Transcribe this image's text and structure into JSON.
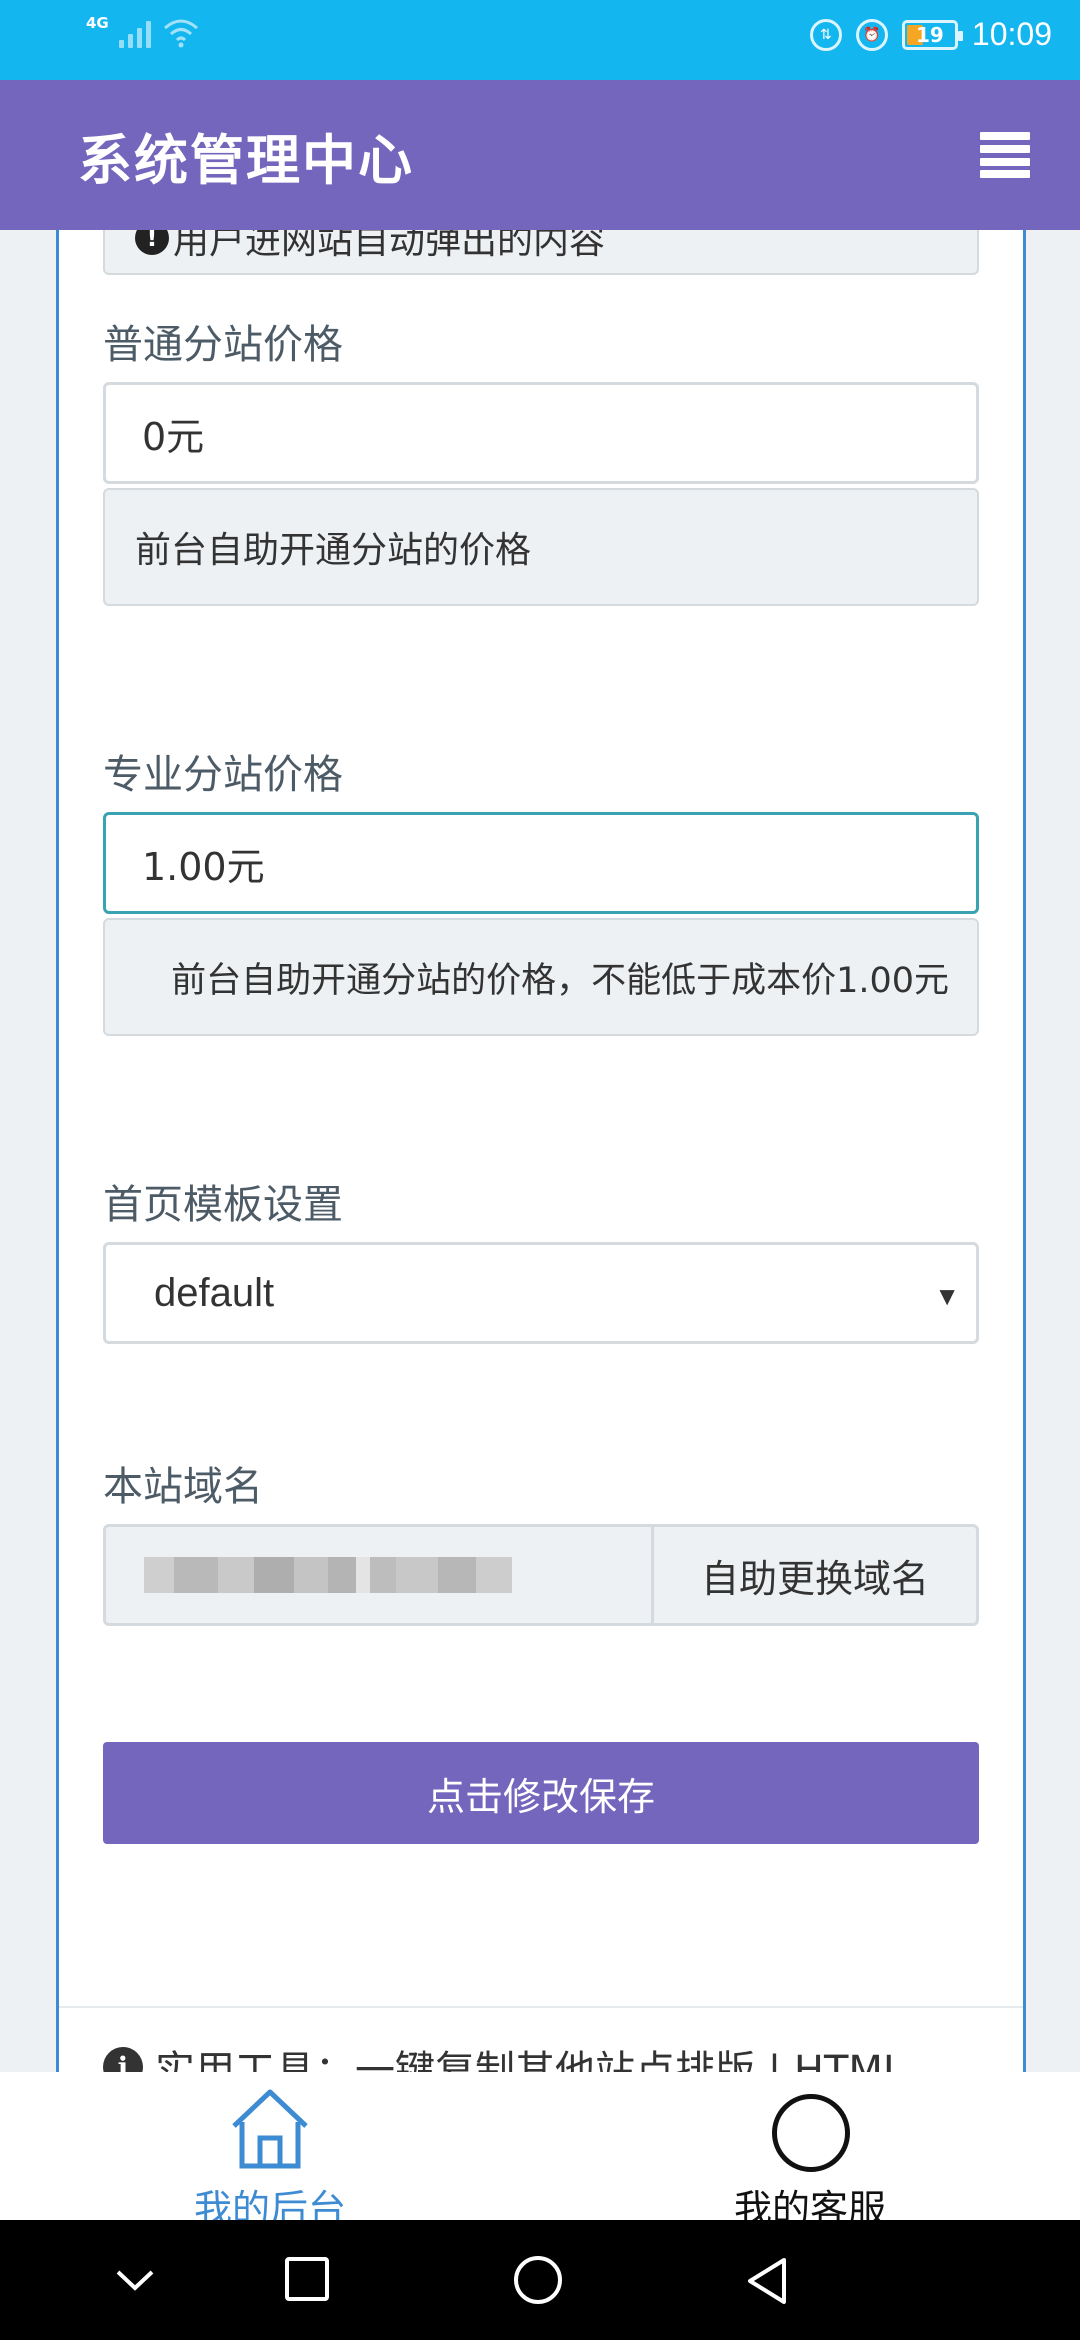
{
  "status_bar": {
    "network": "4G",
    "time": "10:09",
    "battery": "19",
    "icons": [
      "signal-icon",
      "wifi-icon",
      "data-saver-icon",
      "alarm-icon",
      "battery-icon"
    ]
  },
  "header": {
    "title": "系统管理中心",
    "menu_icon": "hamburger-menu-icon"
  },
  "form": {
    "popup_hint": "用户进网站自动弹出的内容",
    "basic_price": {
      "label": "普通分站价格",
      "value": "0元",
      "hint": "前台自助开通分站的价格"
    },
    "pro_price": {
      "label": "专业分站价格",
      "value": "1.00元",
      "hint": "前台自助开通分站的价格，不能低于成本价1.00元"
    },
    "template": {
      "label": "首页模板设置",
      "selected": "default"
    },
    "domain": {
      "label": "本站域名",
      "change_button": "自助更换域名"
    },
    "save_button": "点击修改保存",
    "tools_text": "实用工具：一键复制其他站点排版 | HTML"
  },
  "tabbar": {
    "items": [
      {
        "label": "我的后台",
        "icon": "home-icon",
        "active": true
      },
      {
        "label": "我的客服",
        "icon": "circle-icon",
        "active": false
      }
    ]
  },
  "navbar": {
    "icons": [
      "chevron-down-icon",
      "recent-apps-icon",
      "home-circle-icon",
      "back-triangle-icon"
    ]
  },
  "colors": {
    "status_bar": "#14b6ef",
    "header": "#7466bd",
    "accent_blue": "#3d8bd2",
    "focus_border": "#3aa3b3"
  }
}
